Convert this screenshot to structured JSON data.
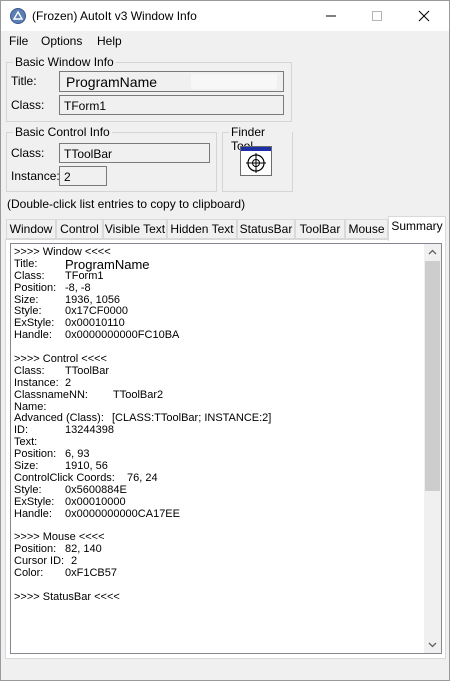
{
  "window": {
    "title": "(Frozen) AutoIt v3 Window Info"
  },
  "menu": [
    "File",
    "Options",
    "Help"
  ],
  "basic_window": {
    "group_label": "Basic Window Info",
    "title_label": "Title:",
    "title_value": "ProgramName",
    "class_label": "Class:",
    "class_value": "TForm1"
  },
  "basic_control": {
    "group_label": "Basic Control Info",
    "class_label": "Class:",
    "class_value": "TToolBar",
    "instance_label": "Instance:",
    "instance_value": "2"
  },
  "finder": {
    "group_label": "Finder Tool",
    "icon": "crosshair-target-icon"
  },
  "hint": "(Double-click list entries to copy to clipboard)",
  "tabs": [
    "Window",
    "Control",
    "Visible Text",
    "Hidden Text",
    "StatusBar",
    "ToolBar",
    "Mouse",
    "Summary"
  ],
  "active_tab": "Summary",
  "summary": [
    {
      "k": ">>>> Window <<<<",
      "v": ""
    },
    {
      "k": "Title:",
      "v": "ProgramName",
      "big": true
    },
    {
      "k": "Class:",
      "v": "TForm1"
    },
    {
      "k": "Position:",
      "v": "-8, -8"
    },
    {
      "k": "Size:",
      "v": "1936, 1056"
    },
    {
      "k": "Style:",
      "v": "0x17CF0000"
    },
    {
      "k": "ExStyle:",
      "v": "0x00010110"
    },
    {
      "k": "Handle:",
      "v": "0x0000000000FC10BA"
    },
    {
      "k": "",
      "v": ""
    },
    {
      "k": ">>>> Control <<<<",
      "v": ""
    },
    {
      "k": "Class:",
      "v": "TToolBar"
    },
    {
      "k": "Instance:",
      "v": "2",
      "tight": true
    },
    {
      "k": "ClassnameNN:",
      "v": "TToolBar2",
      "wide": true
    },
    {
      "k": "Name:",
      "v": ""
    },
    {
      "k": "Advanced (Class):",
      "v": "[CLASS:TToolBar; INSTANCE:2]",
      "adv": true
    },
    {
      "k": "ID:",
      "v": "13244398"
    },
    {
      "k": "Text:",
      "v": ""
    },
    {
      "k": "Position:",
      "v": "6, 93"
    },
    {
      "k": "Size:",
      "v": "1910, 56"
    },
    {
      "k": "ControlClick Coords:",
      "v": "76, 24",
      "cc": true
    },
    {
      "k": "Style:",
      "v": "0x5600884E"
    },
    {
      "k": "ExStyle:",
      "v": "0x00010000"
    },
    {
      "k": "Handle:",
      "v": "0x0000000000CA17EE"
    },
    {
      "k": "",
      "v": ""
    },
    {
      "k": ">>>> Mouse <<<<",
      "v": ""
    },
    {
      "k": "Position:",
      "v": "82, 140"
    },
    {
      "k": "Cursor ID:",
      "v": "2",
      "cursor": true
    },
    {
      "k": "Color:",
      "v": "0xF1CB57"
    },
    {
      "k": "",
      "v": ""
    },
    {
      "k": ">>>> StatusBar <<<<",
      "v": ""
    }
  ]
}
